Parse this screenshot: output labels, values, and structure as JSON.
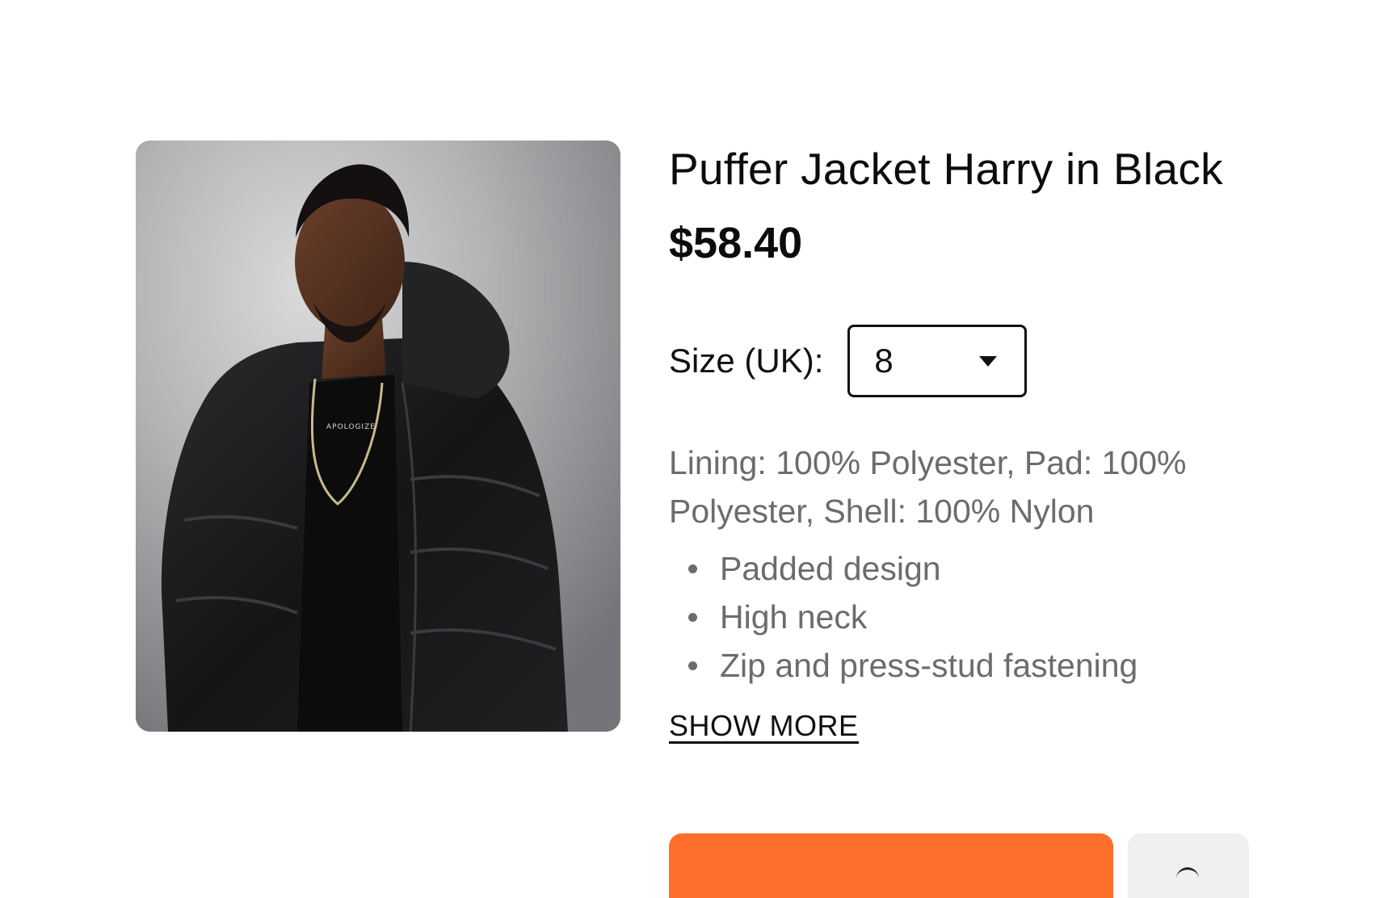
{
  "product": {
    "image": {
      "alt": "Model wearing black puffer jacket",
      "shirt_print": "APOLOGIZE"
    },
    "title": "Puffer Jacket Harry in Black",
    "price": "$58.40",
    "size": {
      "label": "Size (UK):",
      "selected": "8",
      "icon": "caret-down-icon"
    },
    "materials": "Lining: 100% Polyester, Pad: 100% Polyester, Shell: 100% Nylon",
    "features": [
      "Padded design",
      "High neck",
      "Zip and press-stud fastening"
    ],
    "show_more": "SHOW MORE"
  },
  "actions": {
    "add_button_color": "#ff6f2c",
    "wishlist_icon": "heart-icon"
  },
  "colors": {
    "text_primary": "#0c0c0c",
    "text_secondary": "#6b6b70",
    "accent": "#ff6f2c"
  }
}
